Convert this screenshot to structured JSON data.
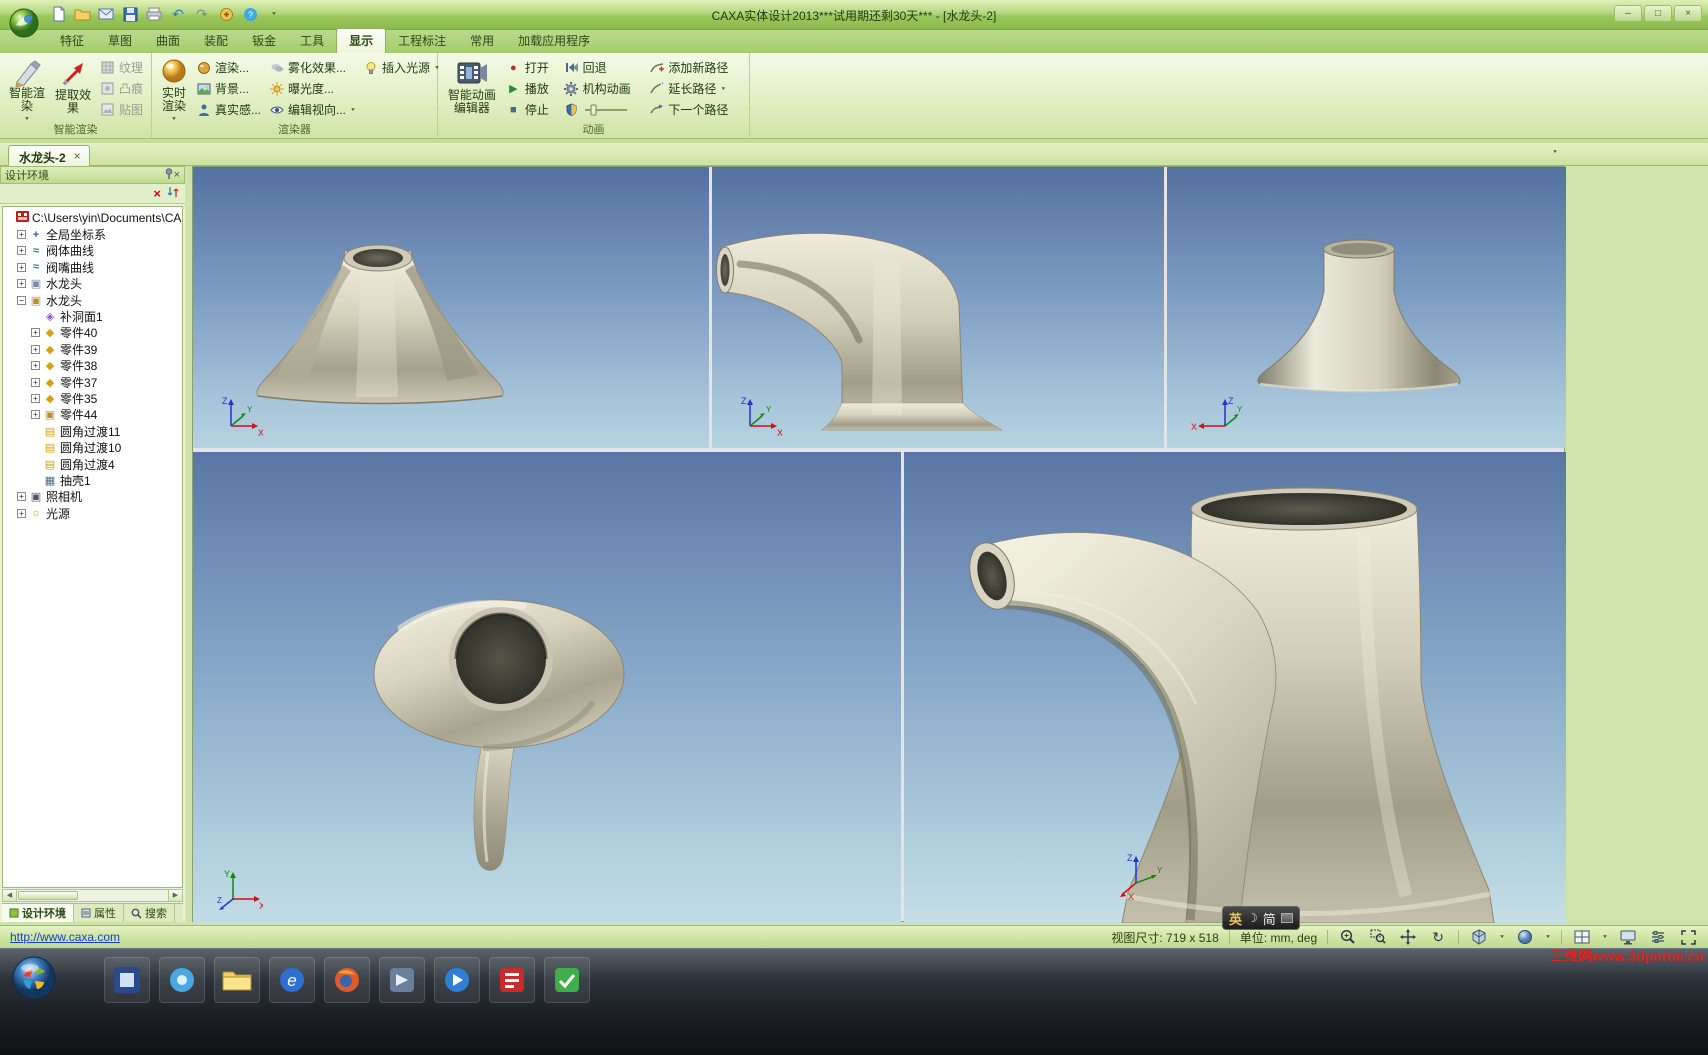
{
  "window": {
    "title": "CAXA实体设计2013***试用期还剩30天*** - [水龙头-2]"
  },
  "ribbon": {
    "tabs": [
      "特征",
      "草图",
      "曲面",
      "装配",
      "钣金",
      "工具",
      "显示",
      "工程标注",
      "常用",
      "加载应用程序"
    ],
    "g1": {
      "title": "智能渲染",
      "big1": "智能渲染",
      "big2": "提取效果",
      "small": [
        "纹理",
        "凸痕",
        "贴图"
      ]
    },
    "g2": {
      "title": "渲染器",
      "big": "实时渲染",
      "a": [
        "渲染...",
        "背景...",
        "真实感..."
      ],
      "b": [
        "雾化效果...",
        "曝光度...",
        "编辑视向..."
      ],
      "insert_light": "插入光源"
    },
    "g3": {
      "title": "动画",
      "big": "智能动画编辑器",
      "c1": [
        "打开",
        "播放",
        "停止"
      ],
      "c2": [
        "回退",
        "机构动画"
      ],
      "c3": [
        "添加新路径",
        "延长路径",
        "下一个路径"
      ]
    }
  },
  "doc_tab": {
    "label": "水龙头-2"
  },
  "sidebar": {
    "title": "设计环境",
    "tree": [
      {
        "label": "C:\\Users\\yin\\Documents\\CA..."
      },
      {
        "label": "全局坐标系"
      },
      {
        "label": "阀体曲线"
      },
      {
        "label": "阀嘴曲线"
      },
      {
        "label": "水龙头"
      },
      {
        "label": "水龙头"
      },
      {
        "label": "补洞面1"
      },
      {
        "label": "零件40"
      },
      {
        "label": "零件39"
      },
      {
        "label": "零件38"
      },
      {
        "label": "零件37"
      },
      {
        "label": "零件35"
      },
      {
        "label": "零件44"
      },
      {
        "label": "圆角过渡11"
      },
      {
        "label": "圆角过渡10"
      },
      {
        "label": "圆角过渡4"
      },
      {
        "label": "抽壳1"
      },
      {
        "label": "照相机"
      },
      {
        "label": "光源"
      }
    ],
    "tabs": [
      "设计环境",
      "属性",
      "搜索"
    ]
  },
  "viewport": {
    "axis_x": "X",
    "axis_y": "Y",
    "axis_z": "Z"
  },
  "status_bar": {
    "link": "http://www.caxa.com",
    "view_size": "视图尺寸: 719 x 518",
    "units": "单位: mm, deg"
  },
  "ime": {
    "lang": "英",
    "mode": "简"
  },
  "watermark": "三维网www.3dportal.cn",
  "icons": {
    "dropdown-arrow": "▼",
    "close": "×",
    "expand": "+",
    "collapse": "−",
    "play": "▶",
    "stop": "■",
    "record": "●",
    "sun": "☼",
    "moon": "☽",
    "coord": "+",
    "curve": "≈",
    "cube": "▣",
    "part": "◆",
    "patch": "◈",
    "fillet": "▤",
    "shell": "▦",
    "camera": "▣"
  }
}
